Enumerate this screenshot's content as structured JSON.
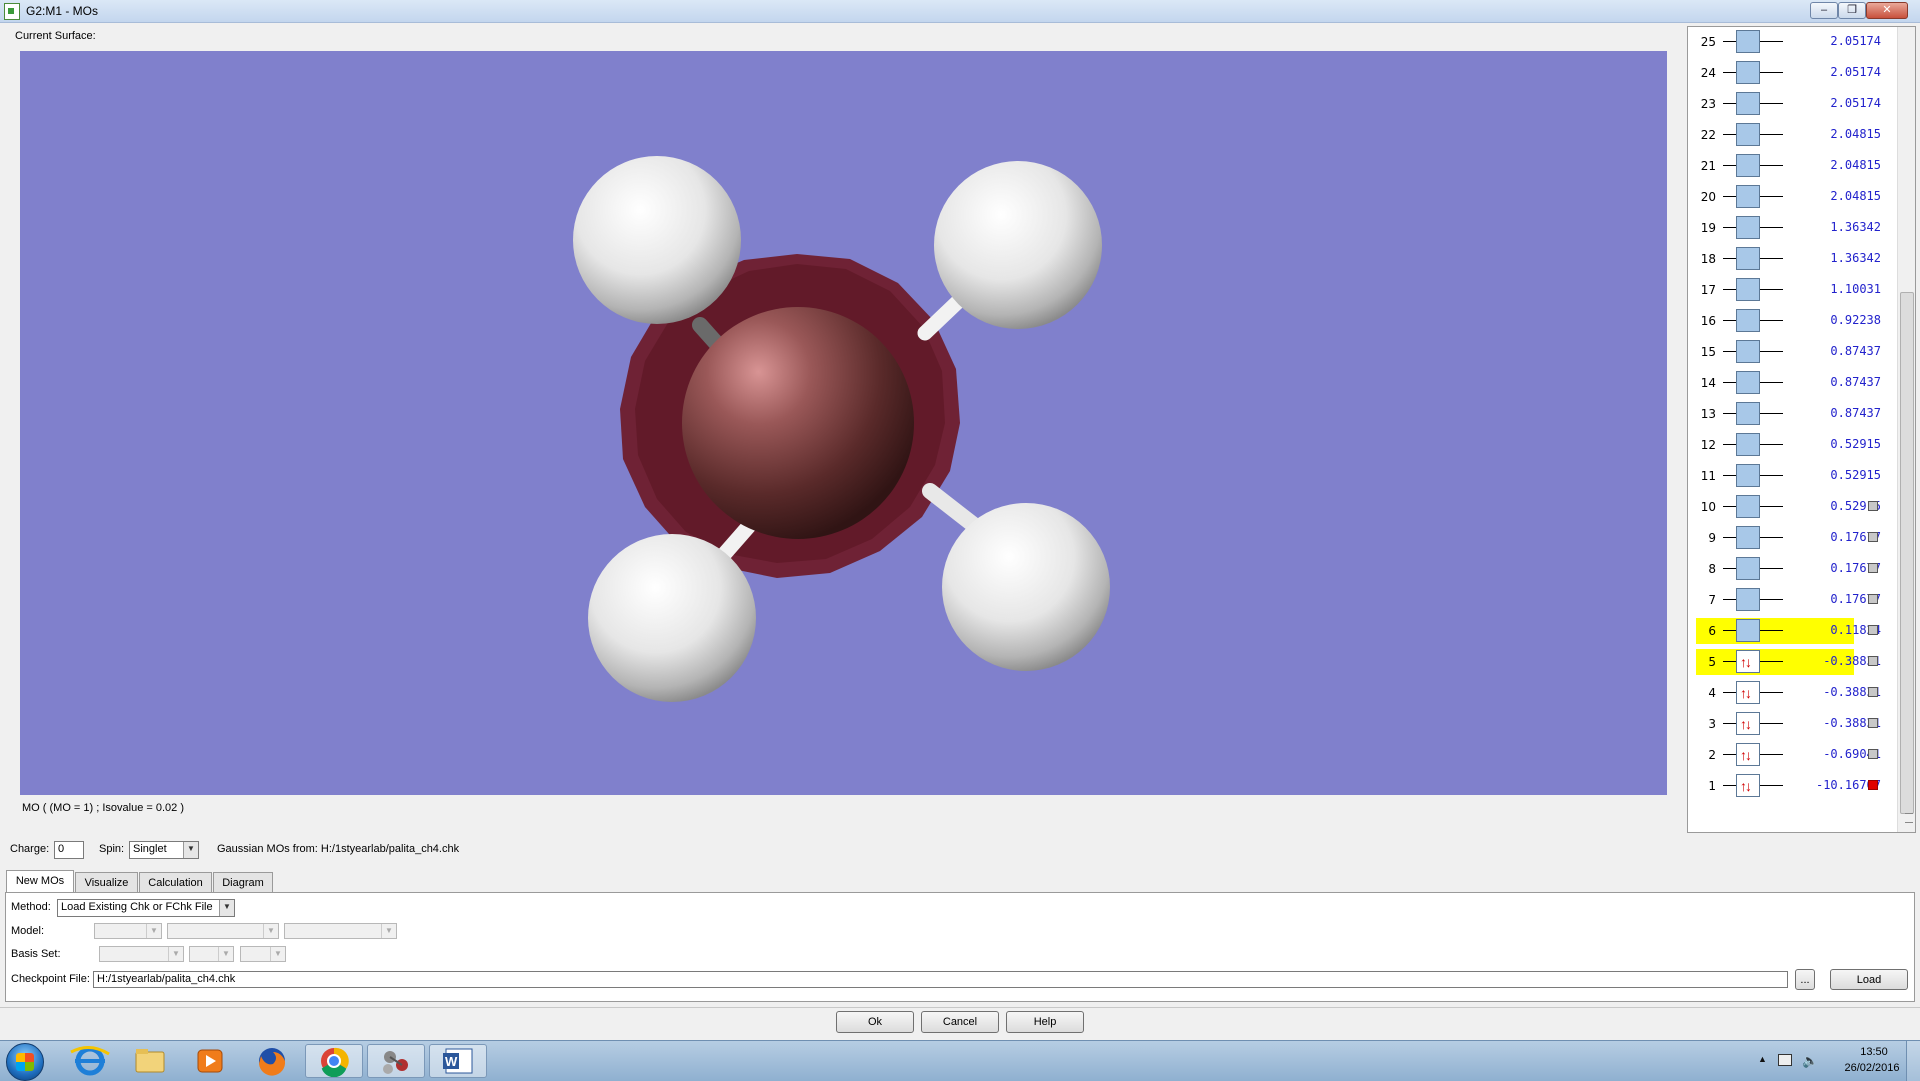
{
  "window": {
    "title": "G2:M1 - MOs",
    "minimize_label": "–",
    "restore_label": "❐",
    "close_label": "✕"
  },
  "viewer": {
    "label": "Current Surface:",
    "info": "MO ( (MO = 1) ; Isovalue = 0.02 )",
    "background_color": "#8080cc"
  },
  "mo_list": [
    {
      "num": "25",
      "energy": "2.05174",
      "occupied": false,
      "highlight": false,
      "checkbox": "none"
    },
    {
      "num": "24",
      "energy": "2.05174",
      "occupied": false,
      "highlight": false,
      "checkbox": "none"
    },
    {
      "num": "23",
      "energy": "2.05174",
      "occupied": false,
      "highlight": false,
      "checkbox": "none"
    },
    {
      "num": "22",
      "energy": "2.04815",
      "occupied": false,
      "highlight": false,
      "checkbox": "none"
    },
    {
      "num": "21",
      "energy": "2.04815",
      "occupied": false,
      "highlight": false,
      "checkbox": "none"
    },
    {
      "num": "20",
      "energy": "2.04815",
      "occupied": false,
      "highlight": false,
      "checkbox": "none"
    },
    {
      "num": "19",
      "energy": "1.36342",
      "occupied": false,
      "highlight": false,
      "checkbox": "none"
    },
    {
      "num": "18",
      "energy": "1.36342",
      "occupied": false,
      "highlight": false,
      "checkbox": "none"
    },
    {
      "num": "17",
      "energy": "1.10031",
      "occupied": false,
      "highlight": false,
      "checkbox": "none"
    },
    {
      "num": "16",
      "energy": "0.92238",
      "occupied": false,
      "highlight": false,
      "checkbox": "none"
    },
    {
      "num": "15",
      "energy": "0.87437",
      "occupied": false,
      "highlight": false,
      "checkbox": "none"
    },
    {
      "num": "14",
      "energy": "0.87437",
      "occupied": false,
      "highlight": false,
      "checkbox": "none"
    },
    {
      "num": "13",
      "energy": "0.87437",
      "occupied": false,
      "highlight": false,
      "checkbox": "none"
    },
    {
      "num": "12",
      "energy": "0.52915",
      "occupied": false,
      "highlight": false,
      "checkbox": "none"
    },
    {
      "num": "11",
      "energy": "0.52915",
      "occupied": false,
      "highlight": false,
      "checkbox": "none"
    },
    {
      "num": "10",
      "energy": "0.52915",
      "occupied": false,
      "highlight": false,
      "checkbox": "gray"
    },
    {
      "num": "9",
      "energy": "0.17677",
      "occupied": false,
      "highlight": false,
      "checkbox": "gray"
    },
    {
      "num": "8",
      "energy": "0.17677",
      "occupied": false,
      "highlight": false,
      "checkbox": "gray"
    },
    {
      "num": "7",
      "energy": "0.17677",
      "occupied": false,
      "highlight": false,
      "checkbox": "gray"
    },
    {
      "num": "6",
      "energy": "0.11824",
      "occupied": false,
      "highlight": true,
      "checkbox": "gray"
    },
    {
      "num": "5",
      "energy": "-0.38831",
      "occupied": true,
      "highlight": true,
      "checkbox": "gray"
    },
    {
      "num": "4",
      "energy": "-0.38831",
      "occupied": true,
      "highlight": false,
      "checkbox": "gray"
    },
    {
      "num": "3",
      "energy": "-0.38831",
      "occupied": true,
      "highlight": false,
      "checkbox": "gray"
    },
    {
      "num": "2",
      "energy": "-0.69041",
      "occupied": true,
      "highlight": false,
      "checkbox": "gray"
    },
    {
      "num": "1",
      "energy": "-10.16707",
      "occupied": true,
      "highlight": false,
      "checkbox": "red"
    }
  ],
  "occupied_arrows": "↑↓",
  "params": {
    "charge_label": "Charge:",
    "charge_value": "0",
    "spin_label": "Spin:",
    "spin_value": "Singlet",
    "source_text": "Gaussian MOs from:  H:/1styearlab/palita_ch4.chk"
  },
  "tabs": [
    "New MOs",
    "Visualize",
    "Calculation",
    "Diagram"
  ],
  "new_mos": {
    "method_label": "Method:",
    "method_value": "Load Existing Chk or FChk File",
    "model_label": "Model:",
    "basis_label": "Basis Set:",
    "checkpoint_label": "Checkpoint File:",
    "checkpoint_value": "H:/1styearlab/palita_ch4.chk",
    "browse_label": "...",
    "load_label": "Load"
  },
  "dialog_buttons": {
    "ok": "Ok",
    "cancel": "Cancel",
    "help": "Help"
  },
  "taskbar": {
    "apps": [
      "start-orb",
      "internet-explorer",
      "file-explorer",
      "media-player",
      "firefox",
      "chrome",
      "gaussview",
      "word"
    ],
    "time": "13:50",
    "date": "26/02/2016"
  },
  "colors": {
    "highlight": "#ffff00",
    "energy_text": "#2222cc",
    "occupied_arrow": "#d00000",
    "virtual_box": "#a8c8e8"
  }
}
